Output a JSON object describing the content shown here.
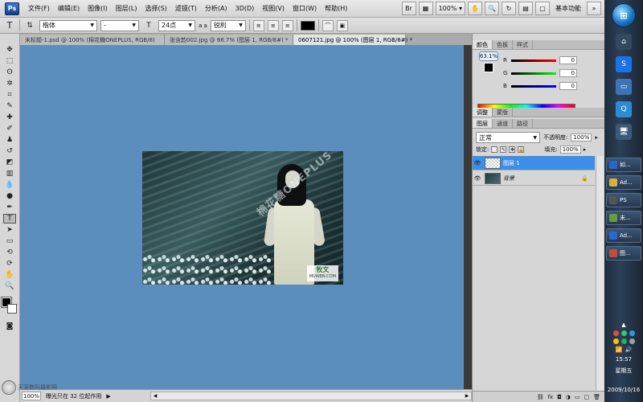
{
  "menubar": {
    "logo": "Ps",
    "items": [
      "文件(F)",
      "编辑(E)",
      "图像(I)",
      "图层(L)",
      "选择(S)",
      "滤镜(T)",
      "分析(A)",
      "3D(D)",
      "视图(V)",
      "窗口(W)",
      "帮助(H)"
    ],
    "zoom": "100%",
    "workspace": "基本功能"
  },
  "options": {
    "tool_icon": "T",
    "font_family": "楷体",
    "font_style": "-",
    "font_size": "24点",
    "aa_label": "a a",
    "antialias": "锐利",
    "text_color": "#000000"
  },
  "tabs": [
    {
      "label": "未标题-1.psd @ 100% (棉花糖ONEPLUS, RGB/8)"
    },
    {
      "label": "张含韵002.jpg @ 66.7% (图层 1, RGB/8#) *"
    },
    {
      "label": "0607121.jpg @ 100% (图层 1, RGB/8#) *"
    }
  ],
  "canvas": {
    "background": "#5b8dbd",
    "photo_watermark": "棉花糖ONEPLUS",
    "corner_logo": "牧文",
    "corner_logo_sub": "MUWEN.COM"
  },
  "status": {
    "zoom": "100%",
    "text": "曝光只在 32 位起作用"
  },
  "color_panel": {
    "tabs": [
      "颜色",
      "色板",
      "样式"
    ],
    "zoom_bubble": "63.1%",
    "r_label": "R",
    "r_value": "0",
    "g_label": "G",
    "g_value": "0",
    "b_label": "B",
    "b_value": "0"
  },
  "adjust_panel": {
    "tabs": [
      "调整",
      "蒙版"
    ]
  },
  "layers_panel": {
    "tabs": [
      "图层",
      "通道",
      "路径"
    ],
    "blend_mode": "正常",
    "opacity_label": "不透明度:",
    "opacity_value": "100%",
    "lock_label": "锁定:",
    "fill_label": "填充:",
    "fill_value": "100%",
    "layers": [
      {
        "name": "图层 1",
        "selected": true
      },
      {
        "name": "背景",
        "selected": false
      }
    ]
  },
  "taskbar": {
    "items": [
      {
        "label": "如...",
        "color": "#2a66c8"
      },
      {
        "label": "Ad...",
        "color": "#d9b13a"
      },
      {
        "label": "PS",
        "color": "#555555"
      },
      {
        "label": "未...",
        "color": "#6a9a3a"
      },
      {
        "label": "Ad...",
        "color": "#2a6ad0"
      },
      {
        "label": "图...",
        "color": "#c84a3a"
      }
    ],
    "time": "15:57",
    "weekday": "星期五",
    "date": "2009/10/16"
  },
  "blog_mark": "天涯数码摄影网"
}
